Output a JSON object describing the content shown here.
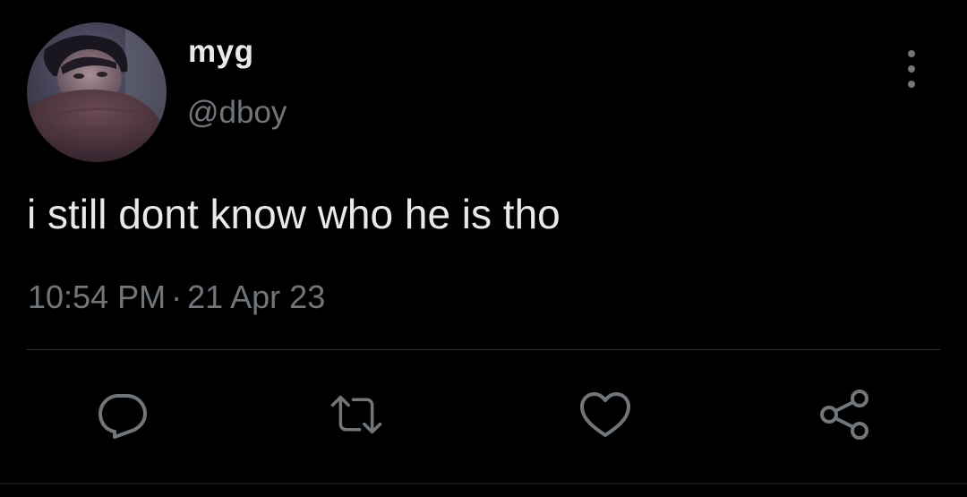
{
  "tweet": {
    "display_name": "myg",
    "handle": "@dboy",
    "text": "i still dont know who he is tho",
    "time": "10:54 PM",
    "separator": "·",
    "date": "21 Apr 23"
  },
  "icons": {
    "more": "more-vertical-icon",
    "reply": "reply-icon",
    "retweet": "retweet-icon",
    "like": "heart-icon",
    "share": "share-icon"
  },
  "colors": {
    "background": "#000000",
    "primary_text": "#e7e9ea",
    "secondary_text": "#71767b",
    "divider": "#2f3336"
  }
}
